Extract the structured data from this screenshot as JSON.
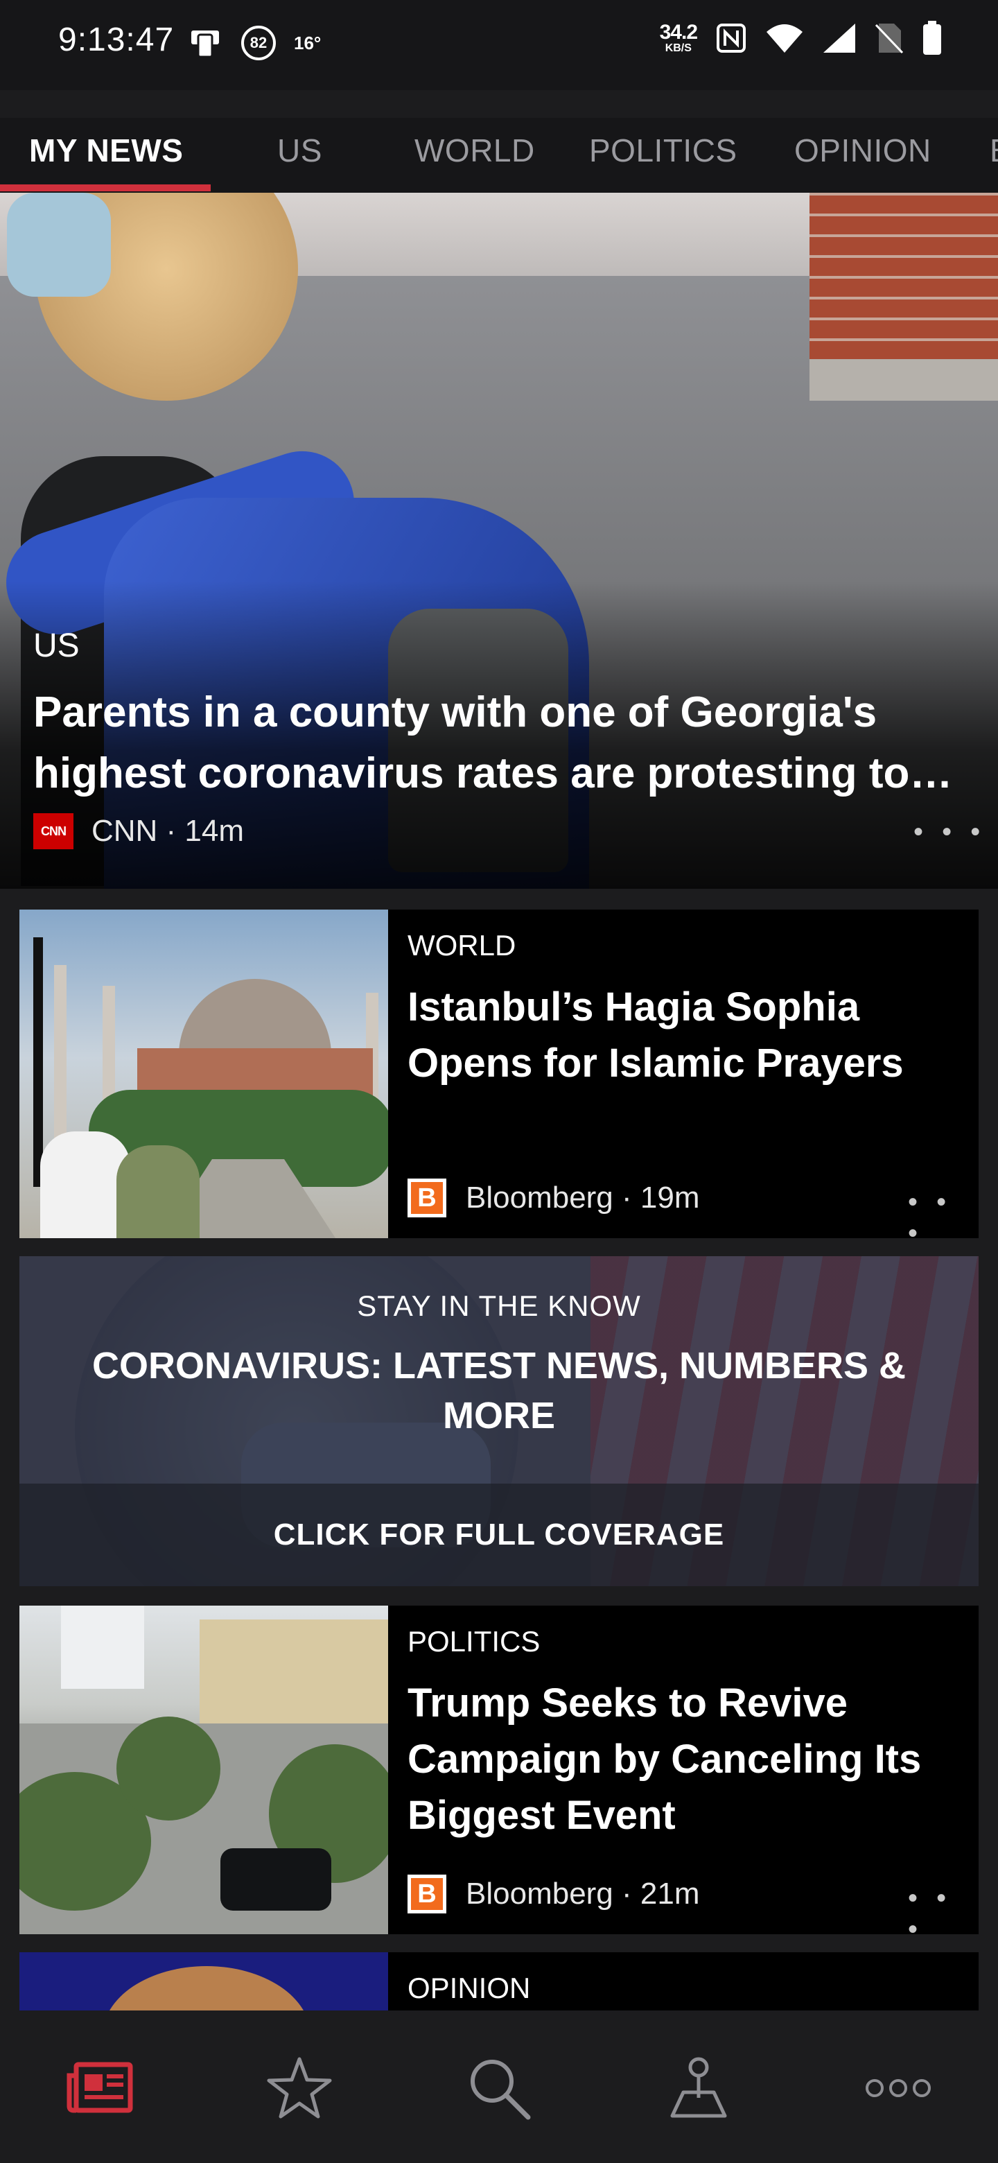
{
  "status_bar": {
    "time": "9:13:47",
    "badge": "82",
    "temp": "16°",
    "net_speed_value": "34.2",
    "net_speed_unit": "KB/S"
  },
  "tabs": [
    {
      "label": "MY NEWS",
      "active": true
    },
    {
      "label": "US",
      "active": false
    },
    {
      "label": "WORLD",
      "active": false
    },
    {
      "label": "POLITICS",
      "active": false
    },
    {
      "label": "OPINION",
      "active": false
    },
    {
      "label": "B",
      "active": false
    }
  ],
  "hero": {
    "category": "US",
    "title": "Parents in a county with one of Georgia's highest coronavirus rates are protesting to…",
    "source_logo": "CNN",
    "source_line": "CNN · 14m",
    "more": "• • •"
  },
  "articles": [
    {
      "category": "WORLD",
      "title": "Istanbul’s Hagia Sophia Opens for Islamic Prayers",
      "source_logo": "B",
      "source_line": "Bloomberg · 19m",
      "more": "• • •"
    },
    {
      "category": "POLITICS",
      "title": "Trump Seeks to Revive Campaign by Canceling Its Biggest Event",
      "source_logo": "B",
      "source_line": "Bloomberg · 21m",
      "more": "• • •"
    },
    {
      "category": "OPINION"
    }
  ],
  "banner": {
    "kicker": "STAY IN THE KNOW",
    "title": "CORONAVIRUS: LATEST NEWS, NUMBERS & MORE",
    "cta": "CLICK FOR FULL COVERAGE"
  },
  "bottom_nav": [
    {
      "icon": "news-icon",
      "active": true
    },
    {
      "icon": "star-icon",
      "active": false
    },
    {
      "icon": "search-icon",
      "active": false
    },
    {
      "icon": "local-map-icon",
      "active": false
    },
    {
      "icon": "more-icon",
      "active": false
    }
  ],
  "colors": {
    "accent": "#d0303c",
    "background": "#1c1c1e",
    "card": "#000000",
    "bloomberg_orange": "#f26b1d"
  }
}
